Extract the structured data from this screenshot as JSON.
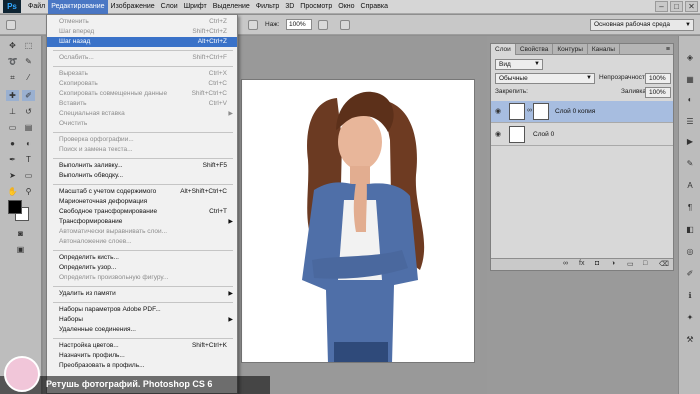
{
  "app": {
    "logo_text": "Ps"
  },
  "menubar": {
    "items": [
      "Файл",
      "Редактирование",
      "Изображение",
      "Слои",
      "Шрифт",
      "Выделение",
      "Фильтр",
      "3D",
      "Просмотр",
      "Окно",
      "Справка"
    ],
    "active_index": 1
  },
  "window_controls": {
    "minimize": "–",
    "maximize": "□",
    "close": "✕"
  },
  "options_bar": {
    "width_label": "Нaж:",
    "zoom_value": "100%",
    "workspace": "Основная рабочая среда"
  },
  "edit_menu": {
    "items": [
      {
        "label": "Отменить",
        "shortcut": "Ctrl+Z",
        "disabled": true
      },
      {
        "label": "Шаг вперед",
        "shortcut": "Shift+Ctrl+Z",
        "disabled": true
      },
      {
        "label": "Шаг назад",
        "shortcut": "Alt+Ctrl+Z",
        "highlight": true
      },
      {
        "label": "Ослабить...",
        "shortcut": "Shift+Ctrl+F",
        "disabled": true
      },
      {
        "label": "Вырезать",
        "shortcut": "Ctrl+X",
        "disabled": true
      },
      {
        "label": "Скопировать",
        "shortcut": "Ctrl+C",
        "disabled": true
      },
      {
        "label": "Скопировать совмещенные данные",
        "shortcut": "Shift+Ctrl+C",
        "disabled": true
      },
      {
        "label": "Вставить",
        "shortcut": "Ctrl+V",
        "disabled": true
      },
      {
        "label": "Специальная вставка",
        "submenu": true,
        "disabled": true
      },
      {
        "label": "Очистить",
        "disabled": true
      },
      {
        "label": "Проверка орфографии...",
        "disabled": true
      },
      {
        "label": "Поиск и замена текста...",
        "disabled": true
      },
      {
        "label": "Выполнить заливку...",
        "shortcut": "Shift+F5"
      },
      {
        "label": "Выполнить обводку..."
      },
      {
        "label": "Масштаб с учетом содержимого",
        "shortcut": "Alt+Shift+Ctrl+C"
      },
      {
        "label": "Марионеточная деформация"
      },
      {
        "label": "Свободное трансформирование",
        "shortcut": "Ctrl+T"
      },
      {
        "label": "Трансформирование",
        "submenu": true
      },
      {
        "label": "Автоматически выравнивать слои...",
        "disabled": true
      },
      {
        "label": "Автоналожение слоев...",
        "disabled": true
      },
      {
        "label": "Определить кисть..."
      },
      {
        "label": "Определить узор..."
      },
      {
        "label": "Определить произвольную фигуру...",
        "disabled": true
      },
      {
        "label": "Удалить из памяти",
        "submenu": true
      },
      {
        "label": "Наборы параметров Adobe PDF..."
      },
      {
        "label": "Наборы",
        "submenu": true
      },
      {
        "label": "Удаленные соединения..."
      },
      {
        "label": "Настройка цветов...",
        "shortcut": "Shift+Ctrl+K"
      },
      {
        "label": "Назначить профиль..."
      },
      {
        "label": "Преобразовать в профиль..."
      }
    ]
  },
  "layers_panel": {
    "tabs": [
      "Слои",
      "Свойства",
      "Контуры",
      "Каналы"
    ],
    "filter": "Вид",
    "blend_mode": "Обычные",
    "opacity_label": "Непрозрачность:",
    "opacity_value": "100%",
    "lock_label": "Закрепить:",
    "fill_label": "Заливка:",
    "fill_value": "100%",
    "layers": [
      {
        "name": "Слой 0 копия",
        "selected": true
      },
      {
        "name": "Слой 0",
        "selected": false
      }
    ],
    "footer_icons": [
      "link-icon",
      "fx-icon",
      "mask-icon",
      "adjustment-icon",
      "folder-icon",
      "new-layer-icon",
      "trash-icon"
    ]
  },
  "caption": {
    "text": "Ретушь фотографий. Photoshop CS 6"
  },
  "colors": {
    "accent": "#3a72c8",
    "menubar": "#d6d6d6",
    "panel": "#d8d8d8"
  }
}
